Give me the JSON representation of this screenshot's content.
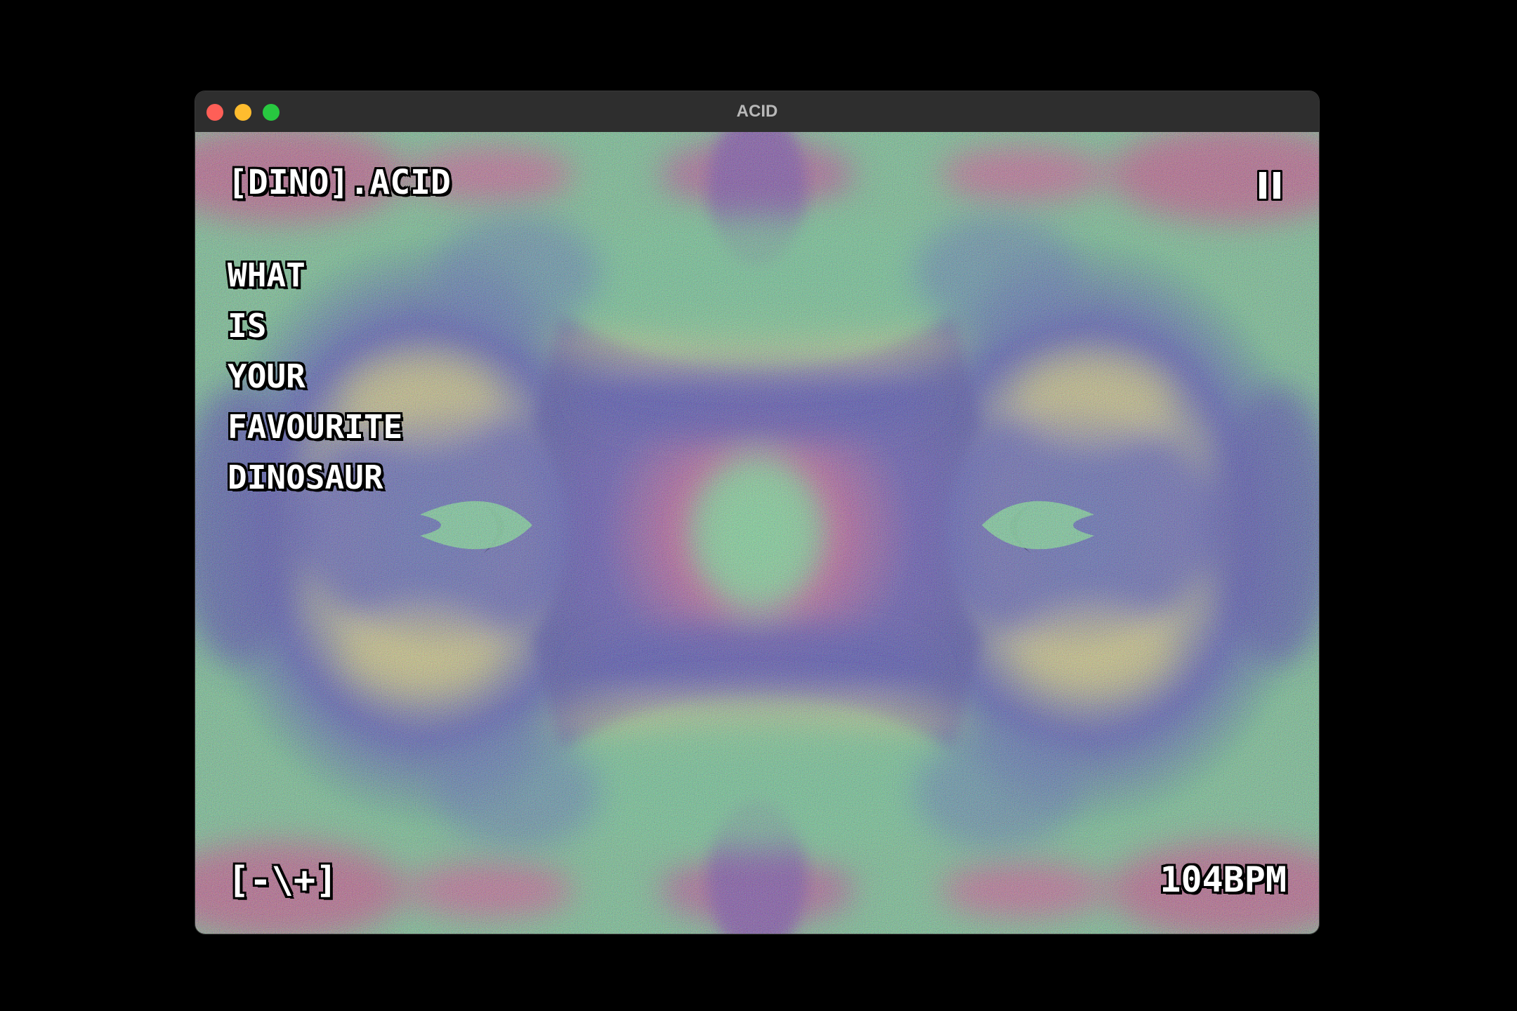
{
  "window": {
    "title": "ACID"
  },
  "sketch": {
    "title": "[DINO].ACID",
    "prompt_lines": [
      "WHAT",
      "IS",
      "YOUR",
      "FAVOURITE",
      "DINOSAUR"
    ],
    "controls_label": "[-\\+]",
    "bpm": "104BPM",
    "pause_icon": "pause-icon"
  },
  "colors": {
    "background": "#000000",
    "titlebar": "#2e2e2e",
    "title_text": "#b8b8b8",
    "traffic_close": "#fe5f57",
    "traffic_minimize": "#febc2e",
    "traffic_maximize": "#28c840",
    "palette": [
      "#6ad08a",
      "#3a3cb0",
      "#c0357a",
      "#d8d070",
      "#4a7ad0"
    ]
  }
}
